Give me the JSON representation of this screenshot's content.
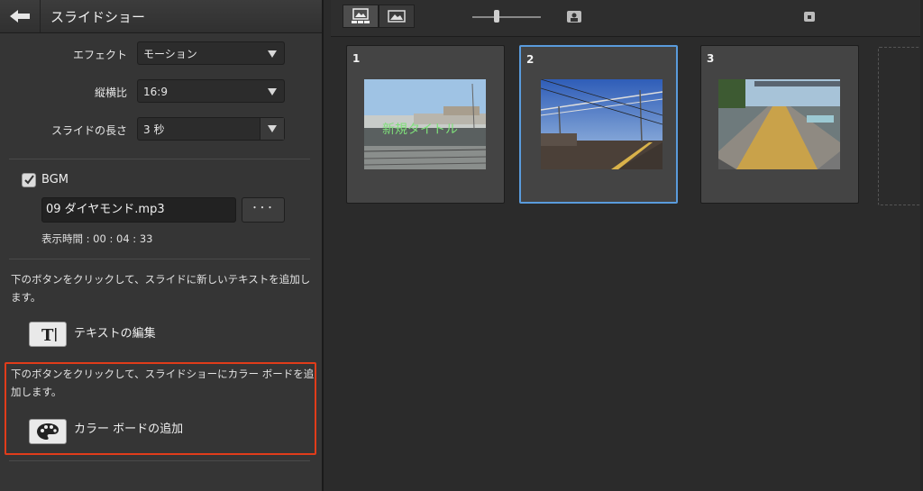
{
  "header": {
    "title": "スライドショー"
  },
  "settings": {
    "effect": {
      "label": "エフェクト",
      "value": "モーション"
    },
    "aspect": {
      "label": "縦横比",
      "value": "16:9"
    },
    "slide_length": {
      "label": "スライドの長さ",
      "value": "3 秒"
    }
  },
  "bgm": {
    "label": "BGM",
    "checked": true,
    "file": "09 ダイヤモンド.mp3",
    "browse_label": "･･･",
    "duration": "表示時間 : 00 : 04 : 33"
  },
  "text_section": {
    "description": "下のボタンをクリックして、スライドに新しいテキストを追加します。",
    "button_label": "テキストの編集"
  },
  "color_board_section": {
    "description": "下のボタンをクリックして、スライドショーにカラー ボードを追加します。",
    "button_label": "カラー ボードの追加"
  },
  "slides": [
    {
      "number": "1",
      "overlay_text": "新規タイトル",
      "selected": false
    },
    {
      "number": "2",
      "selected": true
    },
    {
      "number": "3",
      "selected": false
    }
  ],
  "colors": {
    "highlight": "#e03c1a",
    "selection": "#5a9bdc",
    "panel": "#353535",
    "workspace": "#2b2b2b"
  }
}
